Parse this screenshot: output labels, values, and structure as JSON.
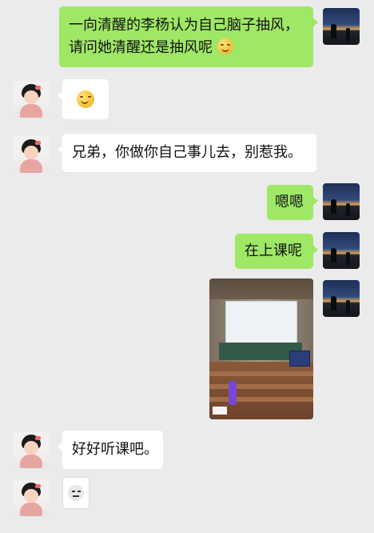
{
  "chat": {
    "messages": [
      {
        "sender": "self",
        "type": "text",
        "lines": [
          "一向清醒的李杨认为自己脑子抽风，",
          "请问她清醒还是抽风呢"
        ],
        "trailing_emoji": "smile"
      },
      {
        "sender": "other",
        "type": "emoji",
        "emoji": "smile"
      },
      {
        "sender": "other",
        "type": "text",
        "text": "兄弟，你做你自己事儿去，别惹我。"
      },
      {
        "sender": "self",
        "type": "text",
        "text": "嗯嗯"
      },
      {
        "sender": "self",
        "type": "text",
        "text": "在上课呢"
      },
      {
        "sender": "self",
        "type": "image",
        "image": "lecture-hall-photo"
      },
      {
        "sender": "other",
        "type": "text",
        "text": "好好听课吧。"
      },
      {
        "sender": "other",
        "type": "sticker",
        "image": "meme-face-sticker"
      }
    ]
  },
  "colors": {
    "background": "#ebebeb",
    "self_bubble": "#9fe866",
    "other_bubble": "#ffffff"
  },
  "icons": {
    "self_avatar": "night-sky-avatar",
    "other_avatar": "child-avatar"
  }
}
